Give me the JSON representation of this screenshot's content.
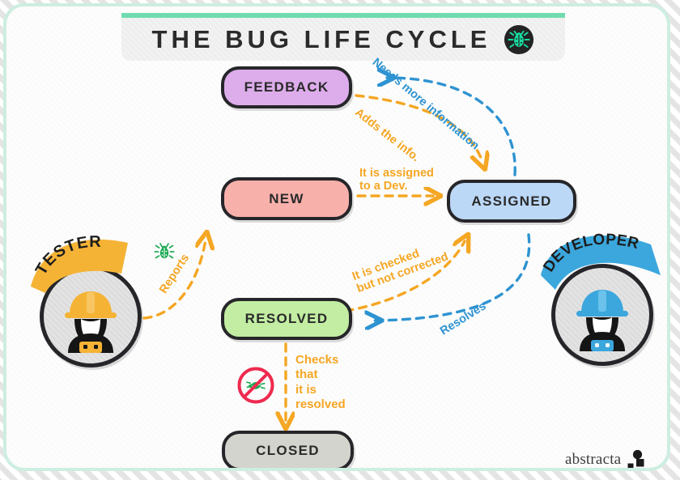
{
  "header": {
    "title": "THE BUG LIFE CYCLE",
    "bug_icon": "bug-in-circle-icon",
    "accent_color": "#6fdcb0",
    "bar_background": "#f2f2f2"
  },
  "canvas": {
    "border_color": "#cdeee0",
    "background": "#fdfdfd"
  },
  "states": [
    {
      "id": "feedback",
      "label": "FEEDBACK",
      "color": "#ddacea"
    },
    {
      "id": "new",
      "label": "NEW",
      "color": "#f8b0ab"
    },
    {
      "id": "assigned",
      "label": "ASSIGNED",
      "color": "#bcd8f7"
    },
    {
      "id": "resolved",
      "label": "RESOLVED",
      "color": "#c2eda2"
    },
    {
      "id": "closed",
      "label": "CLOSED",
      "color": "#d3d4cd"
    }
  ],
  "personas": [
    {
      "id": "tester",
      "label": "TESTER",
      "banner_color": "#f5b335",
      "helmet_color": "#f5b335",
      "disc_color": "#e3e3e3"
    },
    {
      "id": "developer",
      "label": "DEVELOPER",
      "banner_color": "#3ba7dd",
      "helmet_color": "#3ba7dd",
      "disc_color": "#e3e3e3"
    }
  ],
  "transitions": [
    {
      "id": "needs-more-information",
      "label": "Needs more information",
      "color": "#2e93d1",
      "from": "assigned",
      "to": "feedback"
    },
    {
      "id": "adds-the-info",
      "label": "Adds the info.",
      "color": "#f5a623",
      "from": "feedback",
      "to": "assigned"
    },
    {
      "id": "it-is-assigned-to-a-dev",
      "label": "It is assigned\nto a Dev.",
      "color": "#f5a623",
      "from": "new",
      "to": "assigned"
    },
    {
      "id": "it-is-checked-but-not-corrected",
      "label": "It is checked\nbut not corrected",
      "color": "#f5a623",
      "from": "resolved",
      "to": "assigned"
    },
    {
      "id": "resolves",
      "label": "Resolves",
      "color": "#2e93d1",
      "from": "assigned",
      "to": "resolved"
    },
    {
      "id": "reports",
      "label": "Reports",
      "color": "#f5a623",
      "from": "tester",
      "to": "new"
    },
    {
      "id": "checks-that-it-is-resolved",
      "label": "Checks\nthat\nit is\nresolved",
      "color": "#f5a623",
      "from": "resolved",
      "to": "closed"
    }
  ],
  "icons": {
    "bug_green": "bug-icon",
    "no_bug": "no-bug-prohibited-icon"
  },
  "branding": {
    "name": "abstracta",
    "mark": "abstracta-dot-square-mark"
  }
}
